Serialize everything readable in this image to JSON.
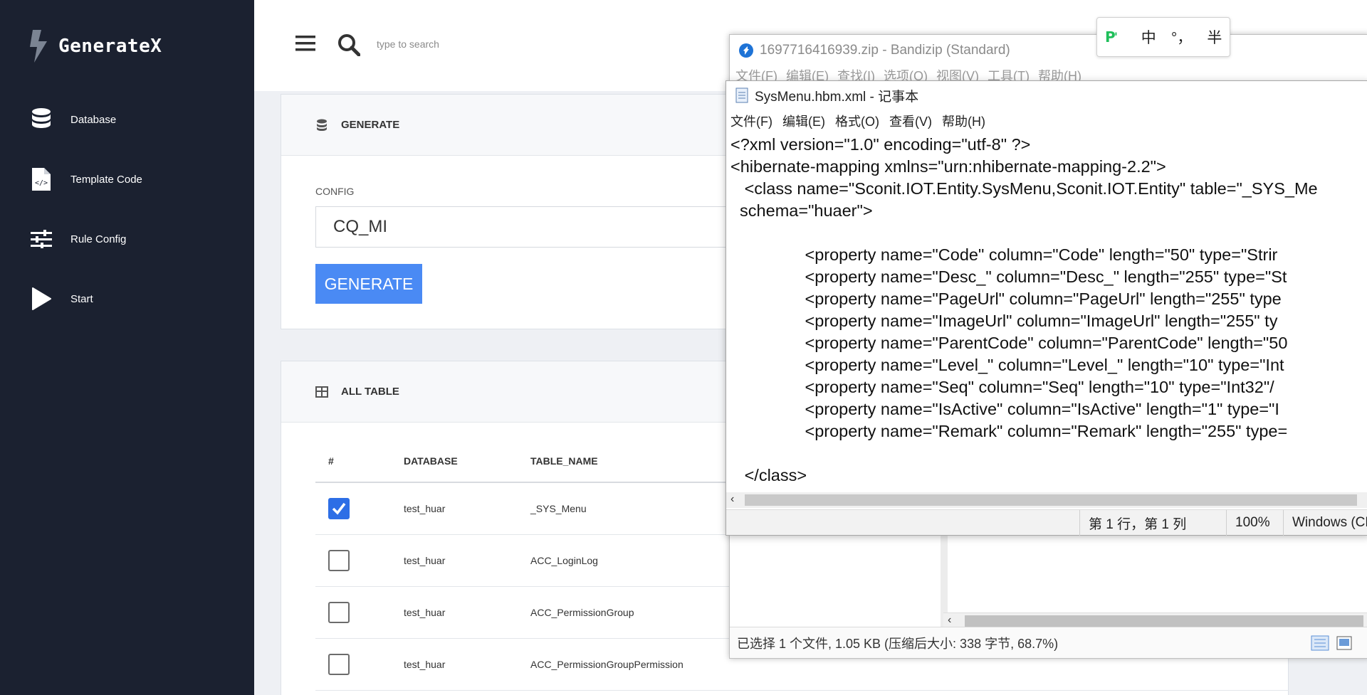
{
  "brand": {
    "name": "GenerateX"
  },
  "sidebar": {
    "items": [
      {
        "label": "Database",
        "icon": "database-icon"
      },
      {
        "label": "Template Code",
        "icon": "code-file-icon"
      },
      {
        "label": "Rule Config",
        "icon": "sliders-icon"
      },
      {
        "label": "Start",
        "icon": "play-icon"
      }
    ]
  },
  "topbar": {
    "search_placeholder": "type to search"
  },
  "generate_card": {
    "title": "GENERATE",
    "config_label": "CONFIG",
    "config_value": "CQ_MI",
    "button_label": "GENERATE"
  },
  "table_card": {
    "title": "ALL TABLE",
    "columns": [
      "#",
      "DATABASE",
      "TABLE_NAME"
    ],
    "rows": [
      {
        "checked": true,
        "database": "test_huar",
        "table_name": "_SYS_Menu"
      },
      {
        "checked": false,
        "database": "test_huar",
        "table_name": "ACC_LoginLog"
      },
      {
        "checked": false,
        "database": "test_huar",
        "table_name": "ACC_PermissionGroup"
      },
      {
        "checked": false,
        "database": "test_huar",
        "table_name": "ACC_PermissionGroupPermission"
      }
    ]
  },
  "bandizip": {
    "title": "1697716416939.zip - Bandizip (Standard)",
    "menu": [
      "文件(F)",
      "编辑(E)",
      "查找(I)",
      "选项(O)",
      "视图(V)",
      "工具(T)",
      "帮助(H)"
    ],
    "status": "已选择 1 个文件, 1.05 KB (压缩后大小: 338 字节, 68.7%)"
  },
  "notepad": {
    "title": "SysMenu.hbm.xml - 记事本",
    "menu": [
      "文件(F)",
      "编辑(E)",
      "格式(O)",
      "查看(V)",
      "帮助(H)"
    ],
    "content": "<?xml version=\"1.0\" encoding=\"utf-8\" ?>\n<hibernate-mapping xmlns=\"urn:nhibernate-mapping-2.2\">\n   <class name=\"Sconit.IOT.Entity.SysMenu,Sconit.IOT.Entity\" table=\"_SYS_Me\n  schema=\"huaer\">\n\n                <property name=\"Code\" column=\"Code\" length=\"50\" type=\"Strir\n                <property name=\"Desc_\" column=\"Desc_\" length=\"255\" type=\"St\n                <property name=\"PageUrl\" column=\"PageUrl\" length=\"255\" type\n                <property name=\"ImageUrl\" column=\"ImageUrl\" length=\"255\" ty\n                <property name=\"ParentCode\" column=\"ParentCode\" length=\"50\n                <property name=\"Level_\" column=\"Level_\" length=\"10\" type=\"Int\n                <property name=\"Seq\" column=\"Seq\" length=\"10\" type=\"Int32\"/\n                <property name=\"IsActive\" column=\"IsActive\" length=\"1\" type=\"I\n                <property name=\"Remark\" column=\"Remark\" length=\"255\" type=\n\n   </class>",
    "status_position": "第 1 行，第 1 列",
    "status_zoom": "100%",
    "status_encoding": "Windows (CF"
  },
  "ime": {
    "mode": "中",
    "punct": "°，",
    "width": "半"
  },
  "colors": {
    "sidebar_bg": "#1b2130",
    "accent": "#4a8af4",
    "checkbox_checked": "#2d6ee6"
  }
}
